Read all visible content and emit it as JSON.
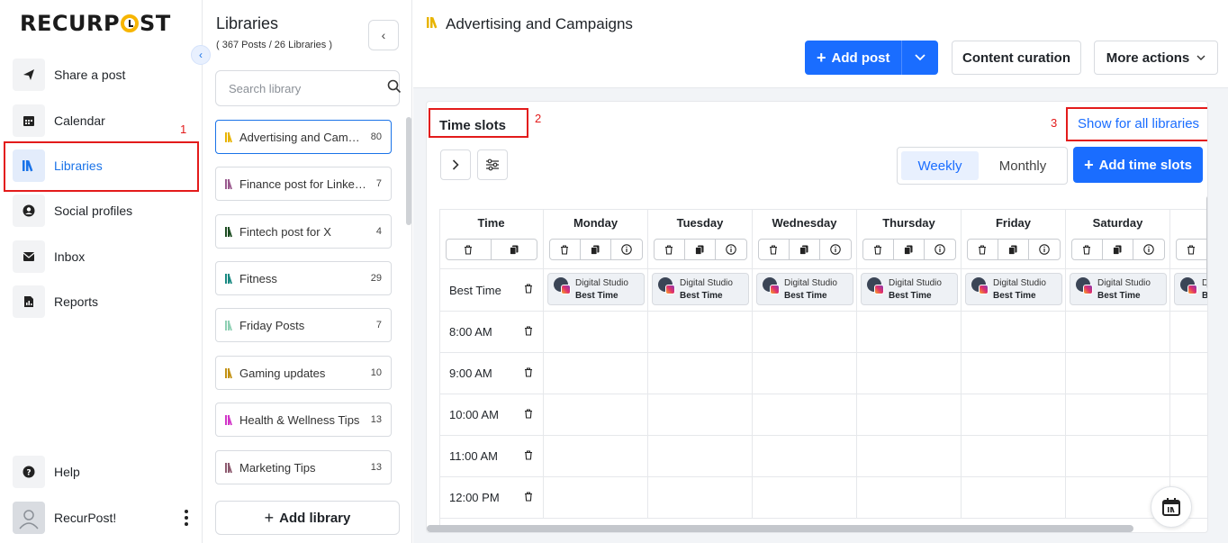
{
  "brand": {
    "logo_text_left": "RECURP",
    "logo_text_right": "ST",
    "accent": "#f7b500"
  },
  "nav": {
    "items": [
      {
        "label": "Share a post",
        "icon": "send-icon"
      },
      {
        "label": "Calendar",
        "icon": "calendar-icon"
      },
      {
        "label": "Libraries",
        "icon": "libraries-icon",
        "active": true
      },
      {
        "label": "Social profiles",
        "icon": "user-circle-icon"
      },
      {
        "label": "Inbox",
        "icon": "inbox-icon"
      },
      {
        "label": "Reports",
        "icon": "report-icon"
      }
    ],
    "help_label": "Help",
    "user_name": "RecurPost!"
  },
  "annotations": {
    "n1": "1",
    "n2": "2",
    "n3": "3"
  },
  "libraries": {
    "title": "Libraries",
    "subtitle": "( 367 Posts / 26 Libraries )",
    "search_placeholder": "Search library",
    "items": [
      {
        "name": "Advertising and Campaigns",
        "count": "80",
        "color": "#e8b400"
      },
      {
        "name": "Finance post for LinkedIn",
        "count": "7",
        "color": "#9b5b8f"
      },
      {
        "name": "Fintech post for X",
        "count": "4",
        "color": "#1d4d22"
      },
      {
        "name": "Fitness",
        "count": "29",
        "color": "#1a8a82"
      },
      {
        "name": "Friday Posts",
        "count": "7",
        "color": "#8fd0b4"
      },
      {
        "name": "Gaming updates",
        "count": "10",
        "color": "#c39214"
      },
      {
        "name": "Health & Wellness Tips",
        "count": "13",
        "color": "#d237c8"
      },
      {
        "name": "Marketing Tips",
        "count": "13",
        "color": "#8d5a6f"
      }
    ],
    "add_label": "Add library"
  },
  "main": {
    "title": "Advertising and Campaigns",
    "add_post_label": "Add post",
    "content_curation_label": "Content curation",
    "more_actions_label": "More actions",
    "primary_color": "#1a6dff"
  },
  "timeslots": {
    "title": "Time slots",
    "show_all_label": "Show for all libraries",
    "view_weekly": "Weekly",
    "view_monthly": "Monthly",
    "add_label": "Add time slots",
    "time_header": "Time",
    "days": [
      "Monday",
      "Tuesday",
      "Wednesday",
      "Thursday",
      "Friday",
      "Saturday",
      "S"
    ],
    "best_time_label": "Best Time",
    "chip_name": "Digital Studio",
    "chip_sub": "Best Time",
    "times": [
      "8:00 AM",
      "9:00 AM",
      "10:00 AM",
      "11:00 AM",
      "12:00 PM"
    ]
  }
}
